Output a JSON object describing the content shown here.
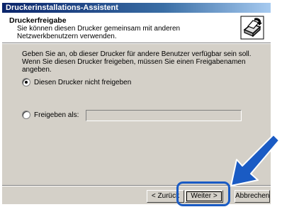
{
  "window": {
    "title": "Druckerinstallations-Assistent"
  },
  "header": {
    "title": "Druckerfreigabe",
    "subtitle": "Sie können diesen Drucker gemeinsam mit anderen Netzwerkbenutzern verwenden.",
    "icon": "printer-share-icon"
  },
  "body": {
    "description": "Geben Sie an, ob dieser Drucker für andere Benutzer verfügbar sein soll. Wenn Sie diesen Drucker freigeben, müssen Sie einen Freigabenamen angeben.",
    "options": [
      {
        "label": "Diesen Drucker nicht freigeben",
        "checked": true
      },
      {
        "label": "Freigeben als:",
        "checked": false
      }
    ],
    "share_name": {
      "value": "",
      "enabled": false
    }
  },
  "buttons": {
    "back": "< Zurück",
    "next": "Weiter >",
    "cancel": "Abbrechen"
  },
  "annotation": {
    "highlight_color": "#1a5bc4",
    "arrow_color": "#1a5bc4",
    "arrow_icon": "pointer-arrow-icon"
  }
}
